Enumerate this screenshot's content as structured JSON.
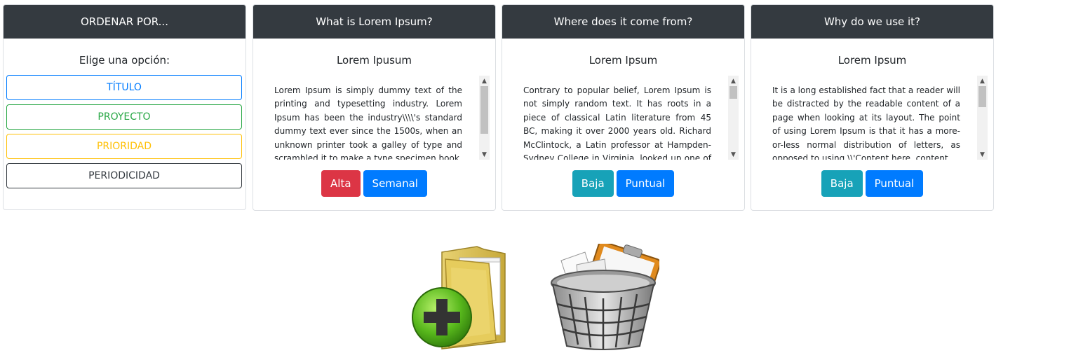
{
  "sort_panel": {
    "header": "ORDENAR POR...",
    "prompt": "Elige una opción:",
    "options": [
      {
        "label": "TÍTULO",
        "color": "#007bff"
      },
      {
        "label": "PROYECTO",
        "color": "#28a745"
      },
      {
        "label": "PRIORIDAD",
        "color": "#ffc107"
      },
      {
        "label": "PERIODICIDAD",
        "color": "#343a40"
      }
    ]
  },
  "tasks": [
    {
      "header": "What is Lorem Ipsum?",
      "subtitle": "Lorem Ipusum",
      "text": "Lorem Ipsum is simply dummy text of the printing and typesetting industry. Lorem Ipsum has been the industry\\\\\\\\'s standard dummy text ever since the 1500s, when an unknown printer took a galley of type and scrambled it to make a type specimen book.",
      "priority": {
        "label": "Alta",
        "color": "#dc3545"
      },
      "frequency": {
        "label": "Semanal",
        "color": "#007bff"
      }
    },
    {
      "header": "Where does it come from?",
      "subtitle": "Lorem Ipsum",
      "text": "Contrary to popular belief, Lorem Ipsum is not simply random text. It has roots in a piece of classical Latin literature from 45 BC, making it over 2000 years old. Richard McClintock, a Latin professor at Hampden-Sydney College in Virginia, looked up one of the more",
      "priority": {
        "label": "Baja",
        "color": "#17a2b8"
      },
      "frequency": {
        "label": "Puntual",
        "color": "#007bff"
      }
    },
    {
      "header": "Why do we use it?",
      "subtitle": "Lorem Ipsum",
      "text": "It is a long established fact that a reader will be distracted by the readable content of a page when looking at its layout. The point of using Lorem Ipsum is that it has a more-or-less normal distribution of letters, as opposed to using \\\\'Content here, content",
      "priority": {
        "label": "Baja",
        "color": "#17a2b8"
      },
      "frequency": {
        "label": "Puntual",
        "color": "#007bff"
      }
    }
  ],
  "icons": {
    "add": "add-folder-icon",
    "delete": "trash-icon",
    "scroll_up": "▲",
    "scroll_down": "▼"
  }
}
